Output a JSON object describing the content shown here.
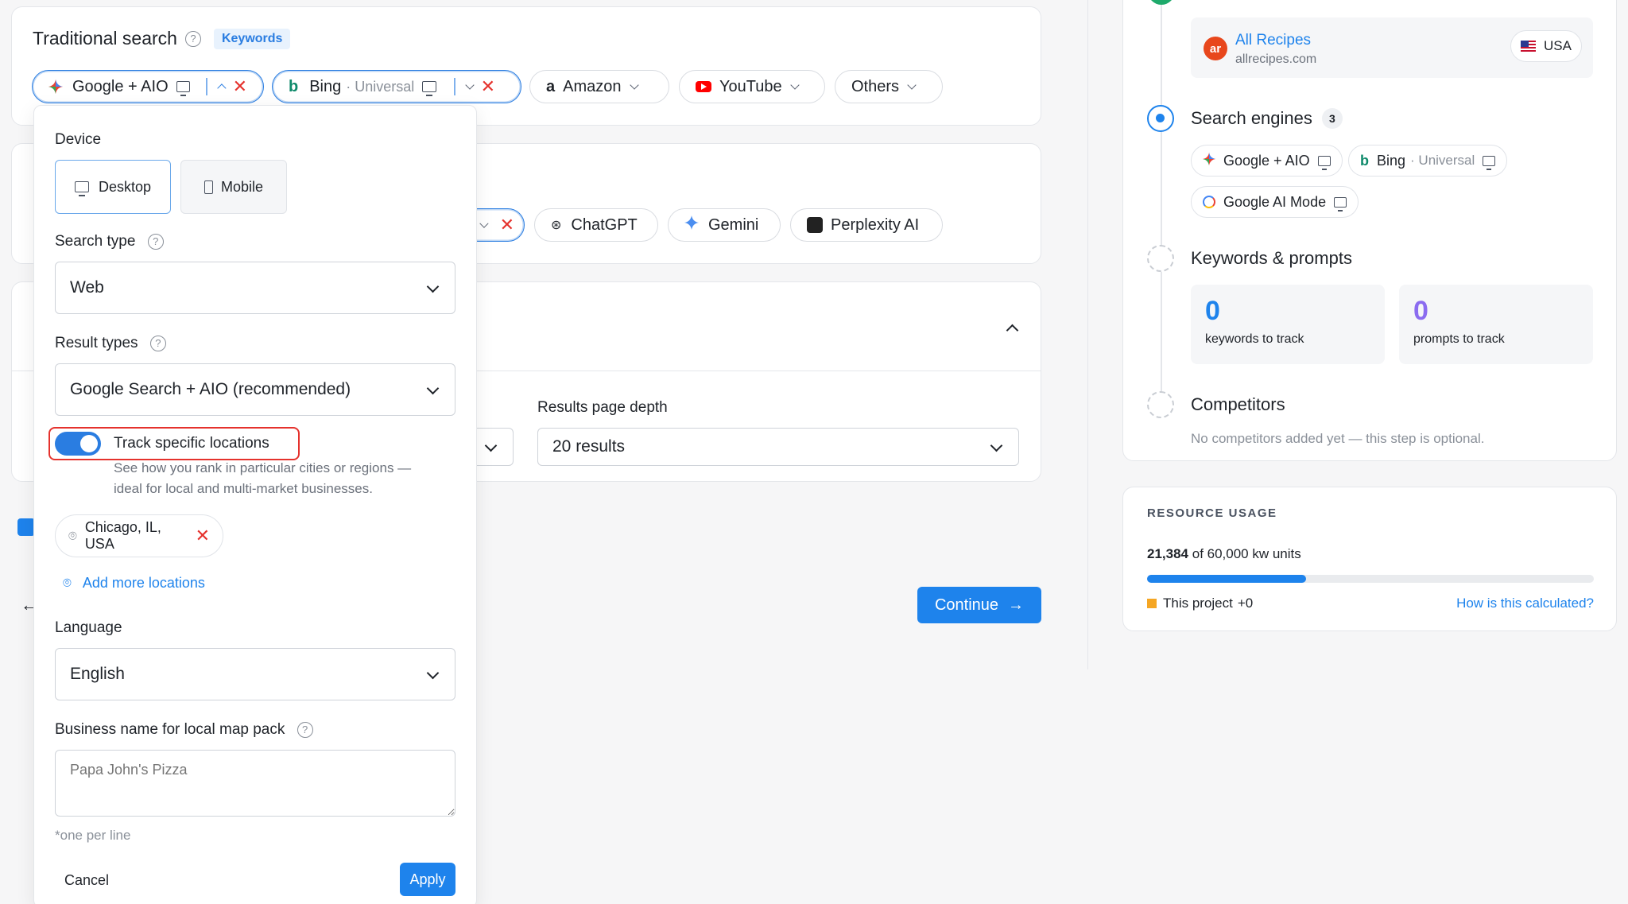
{
  "traditional": {
    "title": "Traditional search",
    "badge": "Keywords",
    "engines": [
      {
        "name": "Google + AIO"
      },
      {
        "name": "Bing",
        "sub": "· Universal"
      },
      {
        "name": "Amazon"
      },
      {
        "name": "YouTube"
      },
      {
        "name": "Others"
      }
    ]
  },
  "ai": {
    "engines": [
      {
        "name": "ChatGPT"
      },
      {
        "name": "Gemini"
      },
      {
        "name": "Perplexity AI"
      }
    ]
  },
  "settings": {
    "depth_label": "Results page depth",
    "depth_value": "20 results"
  },
  "continue_label": "Continue",
  "popup": {
    "device_label": "Device",
    "device_options": [
      "Desktop",
      "Mobile"
    ],
    "search_type_label": "Search type",
    "search_type_value": "Web",
    "result_types_label": "Result types",
    "result_types_value": "Google Search + AIO (recommended)",
    "track_label": "Track specific locations",
    "track_desc_1": "See how you rank in particular cities or regions —",
    "track_desc_2": "ideal for local and multi-market businesses.",
    "location": "Chicago, IL, USA",
    "add_more": "Add more locations",
    "language_label": "Language",
    "language_value": "English",
    "business_label": "Business name for local map pack",
    "business_placeholder": "Papa John's Pizza",
    "one_per_line": "*one per line",
    "cancel": "Cancel",
    "apply": "Apply"
  },
  "sidebar": {
    "site_name": "All Recipes",
    "site_domain": "allrecipes.com",
    "country": "USA",
    "engines_title": "Search engines",
    "engines_count": "3",
    "engine_chips": [
      {
        "name": "Google + AIO"
      },
      {
        "name": "Bing",
        "sub": "· Universal"
      },
      {
        "name": "Google AI Mode"
      }
    ],
    "kw_title": "Keywords & prompts",
    "kw_count": "0",
    "kw_caption": "keywords to track",
    "pr_count": "0",
    "pr_caption": "prompts to track",
    "competitors_title": "Competitors",
    "competitors_desc": "No competitors added yet — this step is optional."
  },
  "usage": {
    "title": "RESOURCE USAGE",
    "used": "21,384",
    "total_text": "of 60,000 kw units",
    "fraction": 0.356,
    "this_project": "This project",
    "this_project_value": "+0",
    "how_link": "How is this calculated?"
  },
  "colors": {
    "accent": "#1e83ec",
    "danger": "#e5322d",
    "prompt_purple": "#8b6cf0",
    "project_orange": "#f5a623"
  }
}
